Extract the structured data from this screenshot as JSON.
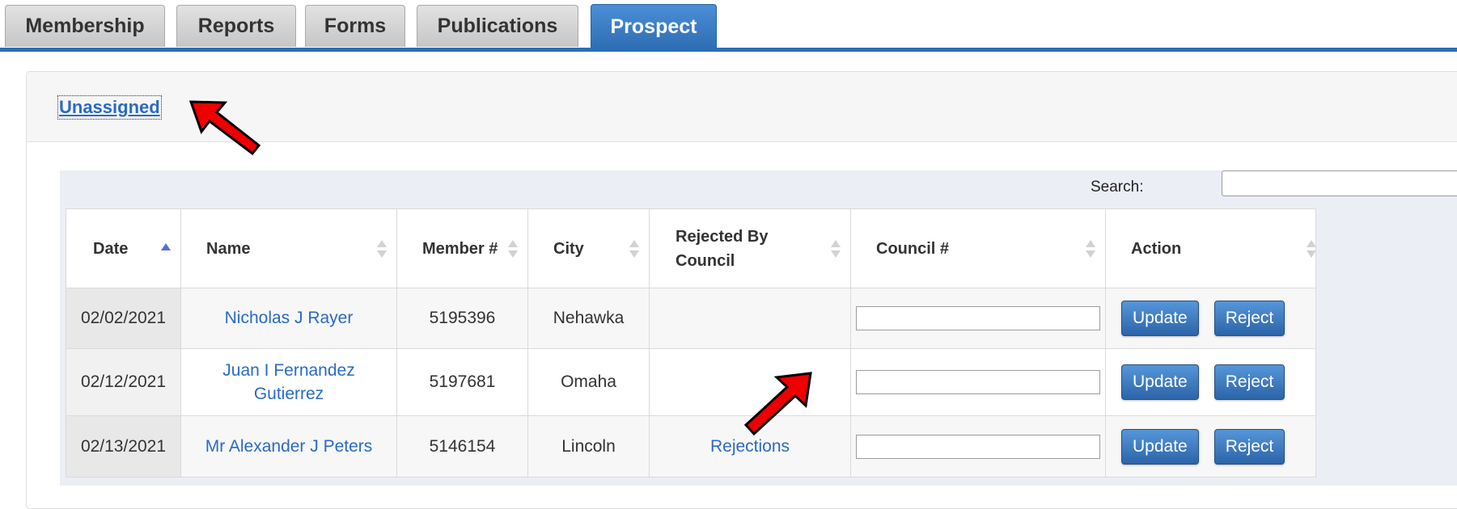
{
  "tabs": [
    {
      "label": "Membership",
      "active": false
    },
    {
      "label": "Reports",
      "active": false
    },
    {
      "label": "Forms",
      "active": false
    },
    {
      "label": "Publications",
      "active": false
    },
    {
      "label": "Prospect",
      "active": true
    }
  ],
  "panel": {
    "link_label": "Unassigned"
  },
  "search": {
    "label": "Search:",
    "value": ""
  },
  "table": {
    "columns": [
      {
        "label": "Date",
        "sort": "asc"
      },
      {
        "label": "Name",
        "sort": "none"
      },
      {
        "label": "Member #",
        "sort": "none"
      },
      {
        "label": "City",
        "sort": "none"
      },
      {
        "label": "Rejected By Council",
        "sort": "none"
      },
      {
        "label": "Council #",
        "sort": "none"
      },
      {
        "label": "Action",
        "sort": "none"
      }
    ],
    "rows": [
      {
        "date": "02/02/2021",
        "name": "Nicholas J Rayer",
        "member": "5195396",
        "city": "Nehawka",
        "rejected": "",
        "council": "",
        "update": "Update",
        "reject": "Reject"
      },
      {
        "date": "02/12/2021",
        "name": "Juan I Fernandez Gutierrez",
        "member": "5197681",
        "city": "Omaha",
        "rejected": "",
        "council": "",
        "update": "Update",
        "reject": "Reject"
      },
      {
        "date": "02/13/2021",
        "name": "Mr Alexander J Peters",
        "member": "5146154",
        "city": "Lincoln",
        "rejected": "Rejections",
        "council": "",
        "update": "Update",
        "reject": "Reject"
      }
    ]
  },
  "colors": {
    "accent": "#2d6db4",
    "link": "#2a6ac4",
    "annotation_arrow": "#ee0000"
  },
  "annotations": [
    {
      "name": "arrow-to-unassigned",
      "icon": "red-arrow-icon"
    },
    {
      "name": "arrow-to-rejections",
      "icon": "red-arrow-icon"
    }
  ]
}
